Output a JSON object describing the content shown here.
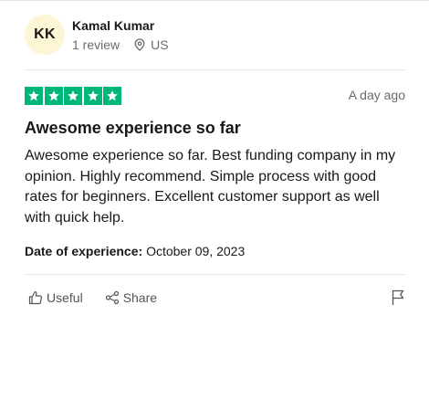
{
  "consumer": {
    "initials": "KK",
    "name": "Kamal Kumar",
    "reviews": "1 review",
    "country": "US",
    "avatar_color": "#fcf6d6"
  },
  "review": {
    "rating": 5,
    "max_rating": 5,
    "star_color": "#00b67a",
    "date_ago": "A day ago",
    "title": "Awesome experience so far",
    "body": "Awesome experience so far. Best funding company in my opinion. Highly recommend. Simple process with good rates for beginners. Excellent customer support as well with quick help.",
    "experience_label": "Date of experience:",
    "experience_date": "October 09, 2023"
  },
  "actions": {
    "useful": "Useful",
    "share": "Share",
    "icons": [
      "thumbs-up-icon",
      "share-icon",
      "flag-icon"
    ]
  }
}
